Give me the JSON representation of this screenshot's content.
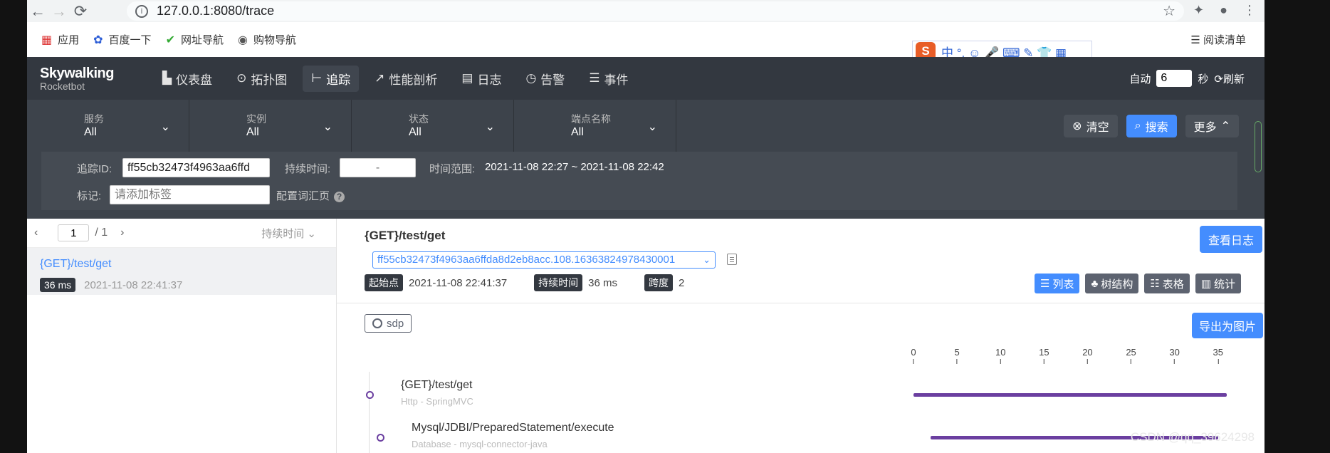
{
  "browser": {
    "url": "127.0.0.1:8080/trace",
    "bookmarks": [
      {
        "label": "应用",
        "icon": "apps-grid-icon"
      },
      {
        "label": "百度一下",
        "icon": "baidu-paw-icon"
      },
      {
        "label": "网址导航",
        "icon": "hao123-icon"
      },
      {
        "label": "购物导航",
        "icon": "globe-icon"
      }
    ],
    "reading_list": "阅读清单",
    "ime_text": "中 °, ☺ 🎤 ⌨ ✎ 👕 ▦"
  },
  "header": {
    "logo_line1": "Skywalking",
    "logo_line2": "Rocketbot",
    "nav": [
      {
        "label": "仪表盘",
        "icon": "dashboard-icon"
      },
      {
        "label": "拓扑图",
        "icon": "topology-icon"
      },
      {
        "label": "追踪",
        "icon": "trace-icon",
        "active": true
      },
      {
        "label": "性能剖析",
        "icon": "profile-icon"
      },
      {
        "label": "日志",
        "icon": "log-icon"
      },
      {
        "label": "告警",
        "icon": "alarm-icon"
      },
      {
        "label": "事件",
        "icon": "event-icon"
      }
    ],
    "auto_label": "自动",
    "auto_value": "6",
    "seconds_label": "秒",
    "refresh_label": "刷新"
  },
  "filter": {
    "selects": [
      {
        "label": "服务",
        "value": "All"
      },
      {
        "label": "实例",
        "value": "All"
      },
      {
        "label": "状态",
        "value": "All"
      },
      {
        "label": "端点名称",
        "value": "All"
      }
    ],
    "clear_label": "清空",
    "search_label": "搜索",
    "more_label": "更多",
    "trace_id_label": "追踪ID:",
    "trace_id_value": "ff55cb32473f4963aa6ffd",
    "duration_label": "持续时间:",
    "duration_placeholder": "-",
    "time_range_label": "时间范围:",
    "time_range_value": "2021-11-08 22:27 ~ 2021-11-08 22:42",
    "tag_label": "标记:",
    "tag_placeholder": "请添加标签",
    "config_label": "配置词汇页"
  },
  "list": {
    "page_value": "1",
    "page_total": "/ 1",
    "sort_label": "持续时间",
    "items": [
      {
        "op": "{GET}/test/get",
        "duration": "36 ms",
        "time": "2021-11-08 22:41:37"
      }
    ]
  },
  "detail": {
    "title": "{GET}/test/get",
    "view_logs": "查看日志",
    "trace_id": "ff55cb32473f4963aa6ffda8d2eb8acc.108.16363824978430001",
    "start_label": "起始点",
    "start_value": "2021-11-08 22:41:37",
    "duration_label": "持续时间",
    "duration_value": "36 ms",
    "span_label": "跨度",
    "span_value": "2",
    "views": [
      {
        "label": "列表",
        "icon": "list-icon",
        "active": true
      },
      {
        "label": "树结构",
        "icon": "tree-icon"
      },
      {
        "label": "表格",
        "icon": "table-icon"
      },
      {
        "label": "统计",
        "icon": "stats-icon"
      }
    ],
    "service_tag": "sdp",
    "export_label": "导出为图片",
    "axis_ticks": [
      "0",
      "5",
      "10",
      "15",
      "20",
      "25",
      "30",
      "35"
    ],
    "axis_max": 36,
    "spans": [
      {
        "name": "{GET}/test/get",
        "sub": "Http - SpringMVC",
        "start": 0,
        "end": 36
      },
      {
        "name": "Mysql/JDBI/PreparedStatement/execute",
        "sub": "Database - mysql-connector-java",
        "start": 2,
        "end": 35
      }
    ]
  },
  "watermark": "CSDN @qq_39624298"
}
